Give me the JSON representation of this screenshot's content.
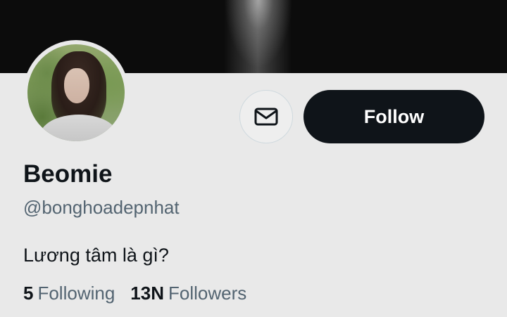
{
  "profile": {
    "display_name": "Beomie",
    "handle": "@bonghoadepnhat",
    "bio": "Lương tâm là gì?"
  },
  "actions": {
    "message_icon": "envelope-icon",
    "follow_label": "Follow"
  },
  "stats": {
    "following_count": "5",
    "following_label": "Following",
    "followers_count": "13N",
    "followers_label": "Followers"
  },
  "colors": {
    "background": "#e9e9e9",
    "primary_button": "#0f1419",
    "secondary_text": "#536471"
  }
}
